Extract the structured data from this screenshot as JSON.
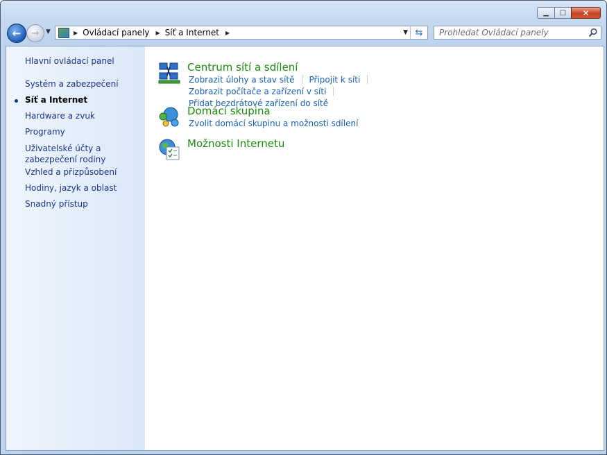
{
  "window": {
    "minimize_glyph": "▁",
    "maximize_glyph": "□",
    "close_glyph": "✕"
  },
  "navigation": {
    "back_glyph": "←",
    "forward_glyph": "→",
    "history_dropdown_glyph": "▼",
    "breadcrumb": [
      "Ovládací panely",
      "Síť a Internet"
    ],
    "breadcrumb_separator": "▶",
    "address_dropdown_glyph": "▼",
    "refresh_glyph": "⇆",
    "search_placeholder": "Prohledat Ovládací panely"
  },
  "sidebar": {
    "home_link": "Hlavní ovládací panel",
    "items": [
      {
        "label": "Systém a zabezpečení",
        "active": false
      },
      {
        "label": "Síť a Internet",
        "active": true
      },
      {
        "label": "Hardware a zvuk",
        "active": false
      },
      {
        "label": "Programy",
        "active": false
      },
      {
        "label": "Uživatelské účty a zabezpečení rodiny",
        "active": false
      },
      {
        "label": "Vzhled a přizpůsobení",
        "active": false
      },
      {
        "label": "Hodiny, jazyk a oblast",
        "active": false
      },
      {
        "label": "Snadný přístup",
        "active": false
      }
    ]
  },
  "categories": [
    {
      "title": "Centrum sítí a sdílení",
      "icon": "network-center-icon",
      "links": [
        "Zobrazit úlohy a stav sítě",
        "Připojit k síti",
        "Zobrazit počítače a zařízení v síti",
        "Přidat bezdrátové zařízení do sítě"
      ]
    },
    {
      "title": "Domácí skupina",
      "icon": "homegroup-icon",
      "links": [
        "Zvolit domácí skupinu a možnosti sdílení"
      ]
    },
    {
      "title": "Možnosti Internetu",
      "icon": "internet-options-icon",
      "links": []
    }
  ],
  "colors": {
    "category_title": "#1e8a12",
    "task_link": "#1a5fb0",
    "sidebar_link": "#1e3287"
  }
}
